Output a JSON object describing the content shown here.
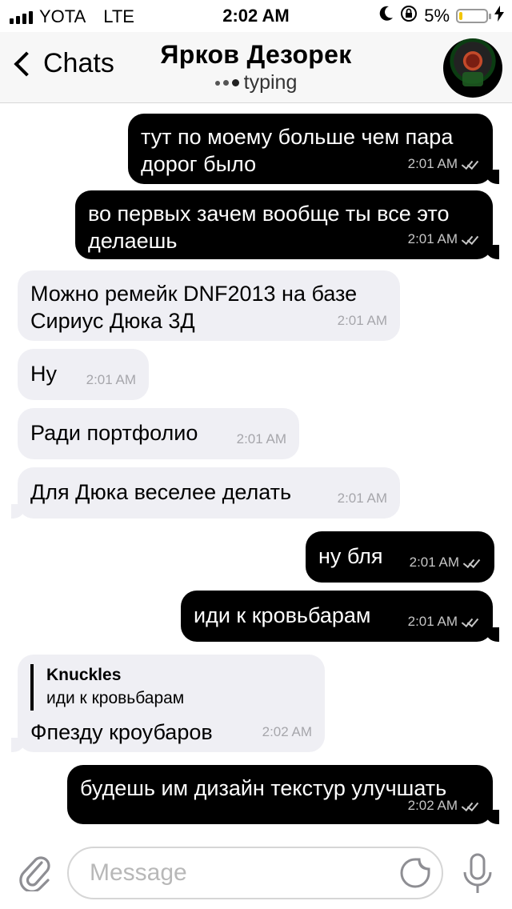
{
  "status_bar": {
    "carrier": "YOTA",
    "network": "LTE",
    "time": "2:02 AM",
    "battery": "5%",
    "battery_level": 0.05
  },
  "header": {
    "back_label": "Chats",
    "title": "Ярков Дезорек",
    "subtitle": "typing"
  },
  "messages": [
    {
      "dir": "out",
      "lines": [
        "тут по моему больше чем пара",
        "дорог было"
      ],
      "time": "2:01 AM"
    },
    {
      "dir": "out",
      "lines": [
        "во первых зачем вообще ты все это",
        "делаешь"
      ],
      "time": "2:01 AM"
    },
    {
      "dir": "in",
      "lines": [
        "Можно ремейк DNF2013 на базе",
        "Сириус Дюка 3Д"
      ],
      "time": "2:01 AM"
    },
    {
      "dir": "in",
      "lines": [
        "Ну"
      ],
      "time": "2:01 AM"
    },
    {
      "dir": "in",
      "lines": [
        "Ради портфолио"
      ],
      "time": "2:01 AM"
    },
    {
      "dir": "in",
      "lines": [
        "Для Дюка веселее делать"
      ],
      "time": "2:01 AM"
    },
    {
      "dir": "out",
      "lines": [
        "ну бля"
      ],
      "time": "2:01 AM"
    },
    {
      "dir": "out",
      "lines": [
        "иди к кровьбарам"
      ],
      "time": "2:01 AM"
    },
    {
      "dir": "in",
      "reply": {
        "name": "Knuckles",
        "text": "иди к кровьбарам"
      },
      "lines": [
        "Фпезду кроубаров"
      ],
      "time": "2:02 AM"
    },
    {
      "dir": "out",
      "lines": [
        "будешь им дизайн текстур улучшать"
      ],
      "time": "2:02 AM"
    }
  ],
  "input": {
    "placeholder": "Message"
  }
}
